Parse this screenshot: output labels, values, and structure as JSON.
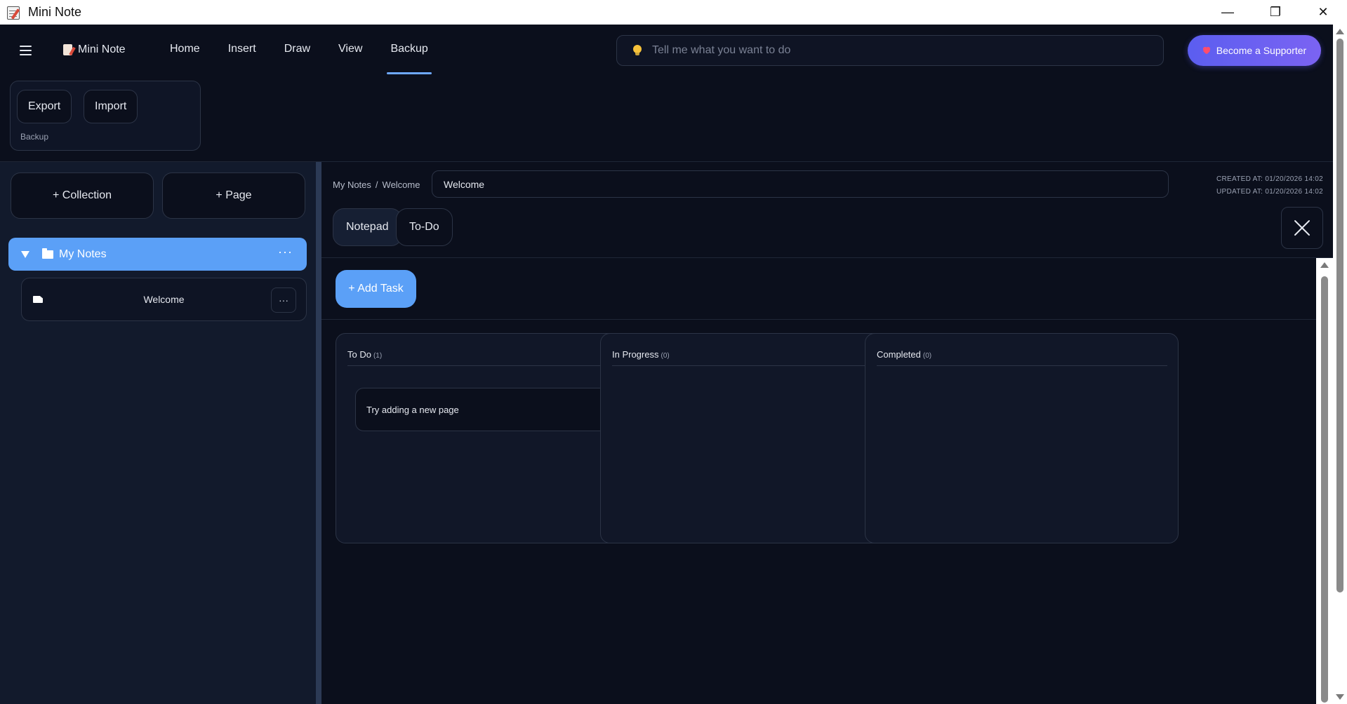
{
  "window": {
    "title": "Mini Note",
    "minimize_glyph": "—",
    "restore_glyph": "❐",
    "close_glyph": "✕"
  },
  "header": {
    "brand": "Mini Note",
    "nav": [
      "Home",
      "Insert",
      "Draw",
      "View",
      "Backup"
    ],
    "active_tab": "Backup",
    "search_placeholder": "Tell me what you want to do",
    "supporter_label": "Become a Supporter"
  },
  "ribbon": {
    "buttons": [
      "Export",
      "Import"
    ],
    "group_label": "Backup"
  },
  "sidebar": {
    "add_collection": "+ Collection",
    "add_page": "+ Page",
    "collection": {
      "name": "My Notes",
      "more": "···"
    },
    "pages": [
      {
        "name": "Welcome",
        "more": "···"
      }
    ]
  },
  "page": {
    "breadcrumb": [
      "My Notes",
      "/",
      "Welcome"
    ],
    "title": "Welcome",
    "created": "CREATED AT: 01/20/2026 14:02",
    "updated": "UPDATED AT: 01/20/2026 14:02",
    "modes": [
      "Notepad",
      "To-Do"
    ],
    "active_mode": "Notepad"
  },
  "todo": {
    "add_task": "+ Add Task",
    "columns": [
      {
        "title": "To Do",
        "count": "(1)",
        "tasks": [
          "Try adding a new page"
        ]
      },
      {
        "title": "In Progress",
        "count": "(0)",
        "tasks": []
      },
      {
        "title": "Completed",
        "count": "(0)",
        "tasks": []
      }
    ]
  },
  "colors": {
    "accent": "#5ba0f7",
    "background": "#0b0f1c",
    "sidebar": "#121a2c",
    "supporter_gradient_start": "#5b5ef0"
  }
}
